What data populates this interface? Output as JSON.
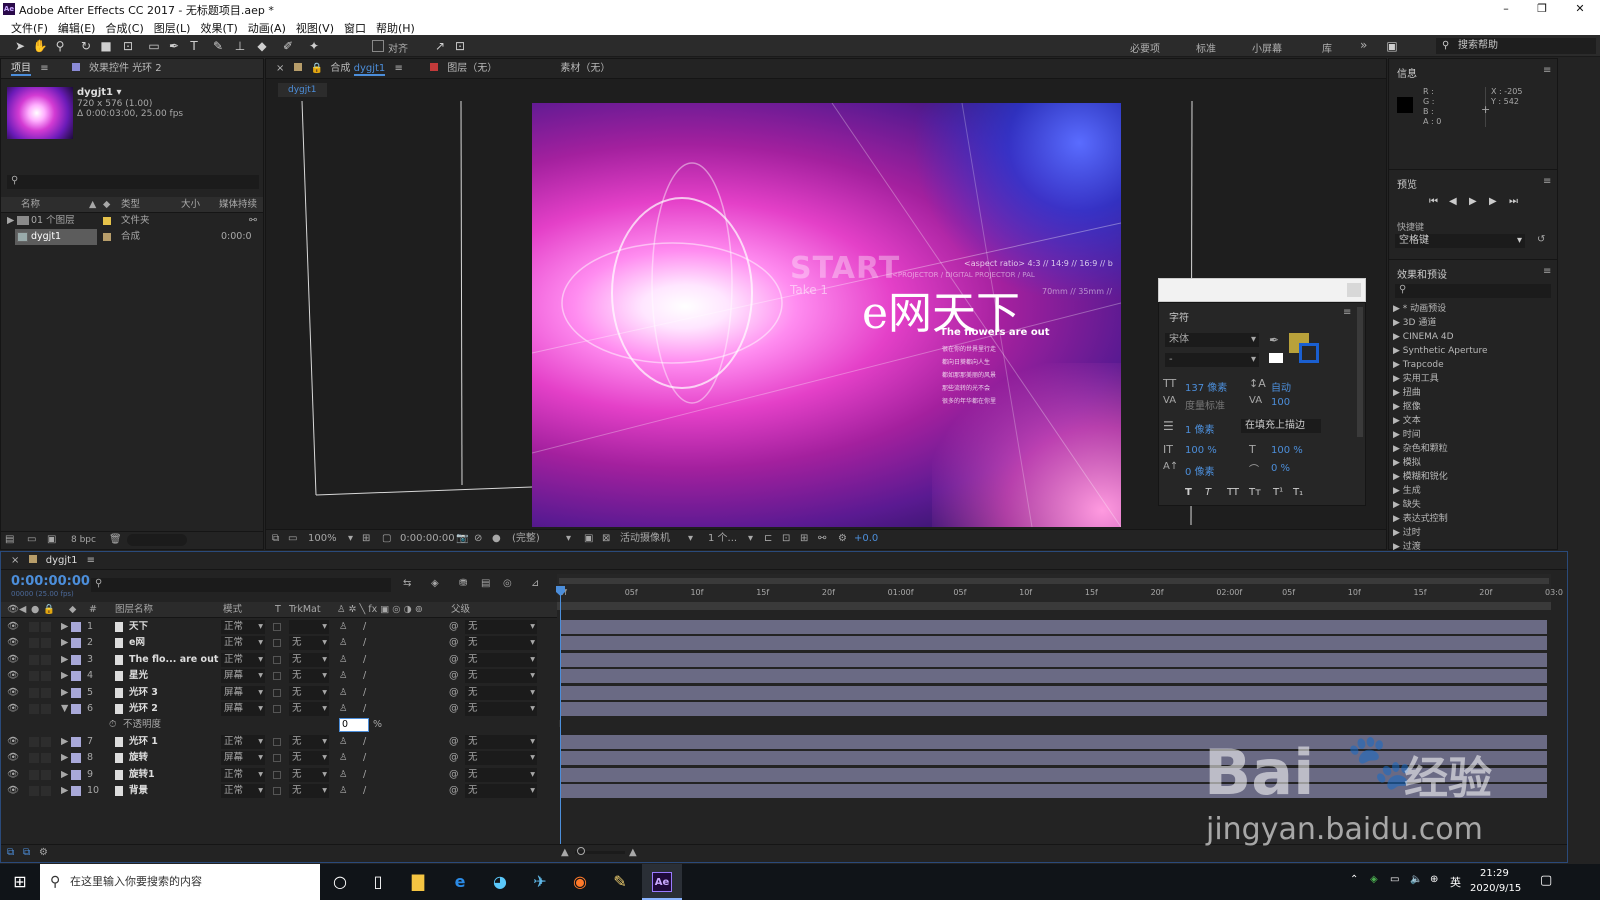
{
  "window": {
    "title": "Adobe After Effects CC 2017 - 无标题项目.aep *",
    "minimize": "–",
    "restore": "❐",
    "close": "✕"
  },
  "menu": [
    "文件(F)",
    "编辑(E)",
    "合成(C)",
    "图层(L)",
    "效果(T)",
    "动画(A)",
    "视图(V)",
    "窗口",
    "帮助(H)"
  ],
  "toolbar": {
    "snap_label": "对齐",
    "workspaces": [
      "必要项",
      "标准",
      "小屏幕",
      "库"
    ],
    "more": "»",
    "help_placeholder": "搜索帮助"
  },
  "project_panel": {
    "tab_project": "项目",
    "tab_effects": "效果控件 光环 2",
    "comp_name": "dygjt1 ▾",
    "comp_meta1": "720 x 576 (1.00)",
    "comp_meta2": "Δ 0:00:03:00, 25.00 fps",
    "search_icon": "⚲",
    "columns": [
      "名称",
      "类型",
      "大小",
      "媒体持续"
    ],
    "items": [
      {
        "name": "01 个图层",
        "type": "文件夹",
        "duration": ""
      },
      {
        "name": "dygjt1",
        "type": "合成",
        "duration": "0:00:0"
      }
    ],
    "footer_bpc": "8 bpc"
  },
  "comp_panel": {
    "tab_comp_prefix": "合成",
    "tab_comp_name": "dygjt1",
    "tab_layer": "图层（无）",
    "tab_footage": "素材（无）",
    "breadcrumb": "dygjt1",
    "zoom": "100%",
    "timecode": "0:00:00:00",
    "resolution": "(完整)",
    "camera": "活动摄像机",
    "views": "1 个...",
    "exposure": "+0.0"
  },
  "artwork": {
    "start_text": "START",
    "take_text": "Take 1",
    "aspect_text": "<aspect ratio> 4:3 // 14:9 // 16:9 // b",
    "projector_text": "<PROJECTOR / DIGITAL PROJECTOR / PAL",
    "film_text": "70mm // 35mm //",
    "headline": "e网天下",
    "subline": "The flowers are out",
    "small_lines": [
      "很在你的世界里行走",
      "都向日葵都向人生",
      "都如那那美丽的风景",
      "那些流转的光不会",
      "很多的年华都在你里"
    ]
  },
  "info_panel": {
    "title": "信息",
    "r": "R :",
    "g": "G :",
    "b": "B :",
    "a": "A : 0",
    "x": "X : -205",
    "y": "Y : 542"
  },
  "preview_panel": {
    "title": "预览",
    "shortcut_label": "快捷键",
    "shortcut_value": "空格键"
  },
  "effects_panel": {
    "title": "效果和预设",
    "items": [
      "* 动画预设",
      "3D 通道",
      "CINEMA 4D",
      "Synthetic Aperture",
      "Trapcode",
      "实用工具",
      "扭曲",
      "抠像",
      "文本",
      "时间",
      "杂色和颗粒",
      "模拟",
      "模糊和锐化",
      "生成",
      "缺失",
      "表达式控制",
      "过时",
      "过渡"
    ]
  },
  "char_panel": {
    "title": "字符",
    "font_family": "宋体",
    "font_style": "-",
    "size": "137 像素",
    "leading": "自动",
    "kerning": "度量标准",
    "tracking": "100",
    "stroke_width": "1 像素",
    "stroke_type": "在填充上描边",
    "v_scale": "100 %",
    "h_scale": "100 %",
    "baseline": "0 像素",
    "tsume": "0 %",
    "styles": [
      "T",
      "T",
      "TT",
      "Tт",
      "T¹",
      "T₁"
    ],
    "fill_color": "#b8a13a",
    "stroke_color": "#1a5fd0"
  },
  "timeline": {
    "tab": "dygjt1",
    "timecode": "0:00:00:00",
    "frameinfo": "00000 (25.00 fps)",
    "columns": {
      "num": "#",
      "name": "图层名称",
      "mode": "模式",
      "t": "T",
      "trkmat": "TrkMat",
      "parent": "父级"
    },
    "ruler": [
      "0f",
      "05f",
      "10f",
      "15f",
      "20f",
      "01:00f",
      "05f",
      "10f",
      "15f",
      "20f",
      "02:00f",
      "05f",
      "10f",
      "15f",
      "20f",
      "03:0"
    ],
    "layers": [
      {
        "num": "1",
        "name": "天下",
        "mode": "正常",
        "trk": "",
        "parent": "无"
      },
      {
        "num": "2",
        "name": "e网",
        "mode": "正常",
        "trk": "无",
        "parent": "无"
      },
      {
        "num": "3",
        "name": "The flo... are out",
        "mode": "正常",
        "trk": "无",
        "parent": "无"
      },
      {
        "num": "4",
        "name": "星光",
        "mode": "屏幕",
        "trk": "无",
        "parent": "无"
      },
      {
        "num": "5",
        "name": "光环 3",
        "mode": "屏幕",
        "trk": "无",
        "parent": "无"
      },
      {
        "num": "6",
        "name": "光环 2",
        "mode": "屏幕",
        "trk": "无",
        "parent": "无"
      }
    ],
    "opacity_label": "不透明度",
    "opacity_value": "0",
    "opacity_unit": "%",
    "layers_after": [
      {
        "num": "7",
        "name": "光环 1",
        "mode": "正常",
        "trk": "无",
        "parent": "无"
      },
      {
        "num": "8",
        "name": "旋转",
        "mode": "屏幕",
        "trk": "无",
        "parent": "无"
      },
      {
        "num": "9",
        "name": "旋转1",
        "mode": "正常",
        "trk": "无",
        "parent": "无"
      },
      {
        "num": "10",
        "name": "背景",
        "mode": "正常",
        "trk": "无",
        "parent": "无"
      }
    ]
  },
  "watermark": {
    "brand": "Bai",
    "brand2": "经验",
    "url": "jingyan.baidu.com"
  },
  "taskbar": {
    "search_placeholder": "在这里输入你要搜索的内容",
    "time": "21:29",
    "date": "2020/9/15",
    "ime": "英"
  }
}
